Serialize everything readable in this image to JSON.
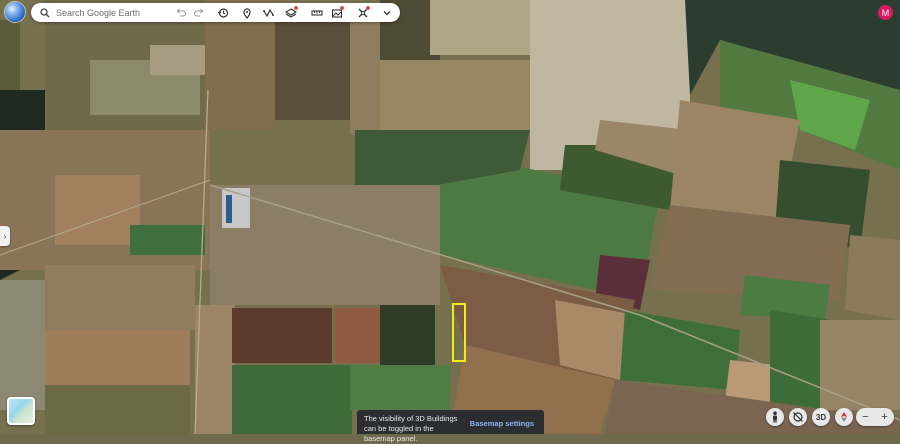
{
  "search": {
    "placeholder": "Search Google Earth"
  },
  "toolbar": {
    "tools": [
      "undo-icon",
      "redo-icon",
      "history-icon",
      "place-pin-icon",
      "path-icon",
      "layers-icon",
      "measure-icon",
      "projects-icon",
      "satellite-icon",
      "more-chevron-icon"
    ]
  },
  "user": {
    "avatar_initial": "M"
  },
  "notice": {
    "message": "The visibility of 3D Buildings can be toggled in the basemap panel.",
    "action": "Basemap settings"
  },
  "controls": {
    "mode_3d": "3D",
    "zoom_in": "+",
    "zoom_out": "−"
  },
  "colors": {
    "highlight": "#f2ea1a",
    "accent": "#8ab4f8",
    "avatar_bg": "#d81b60"
  }
}
